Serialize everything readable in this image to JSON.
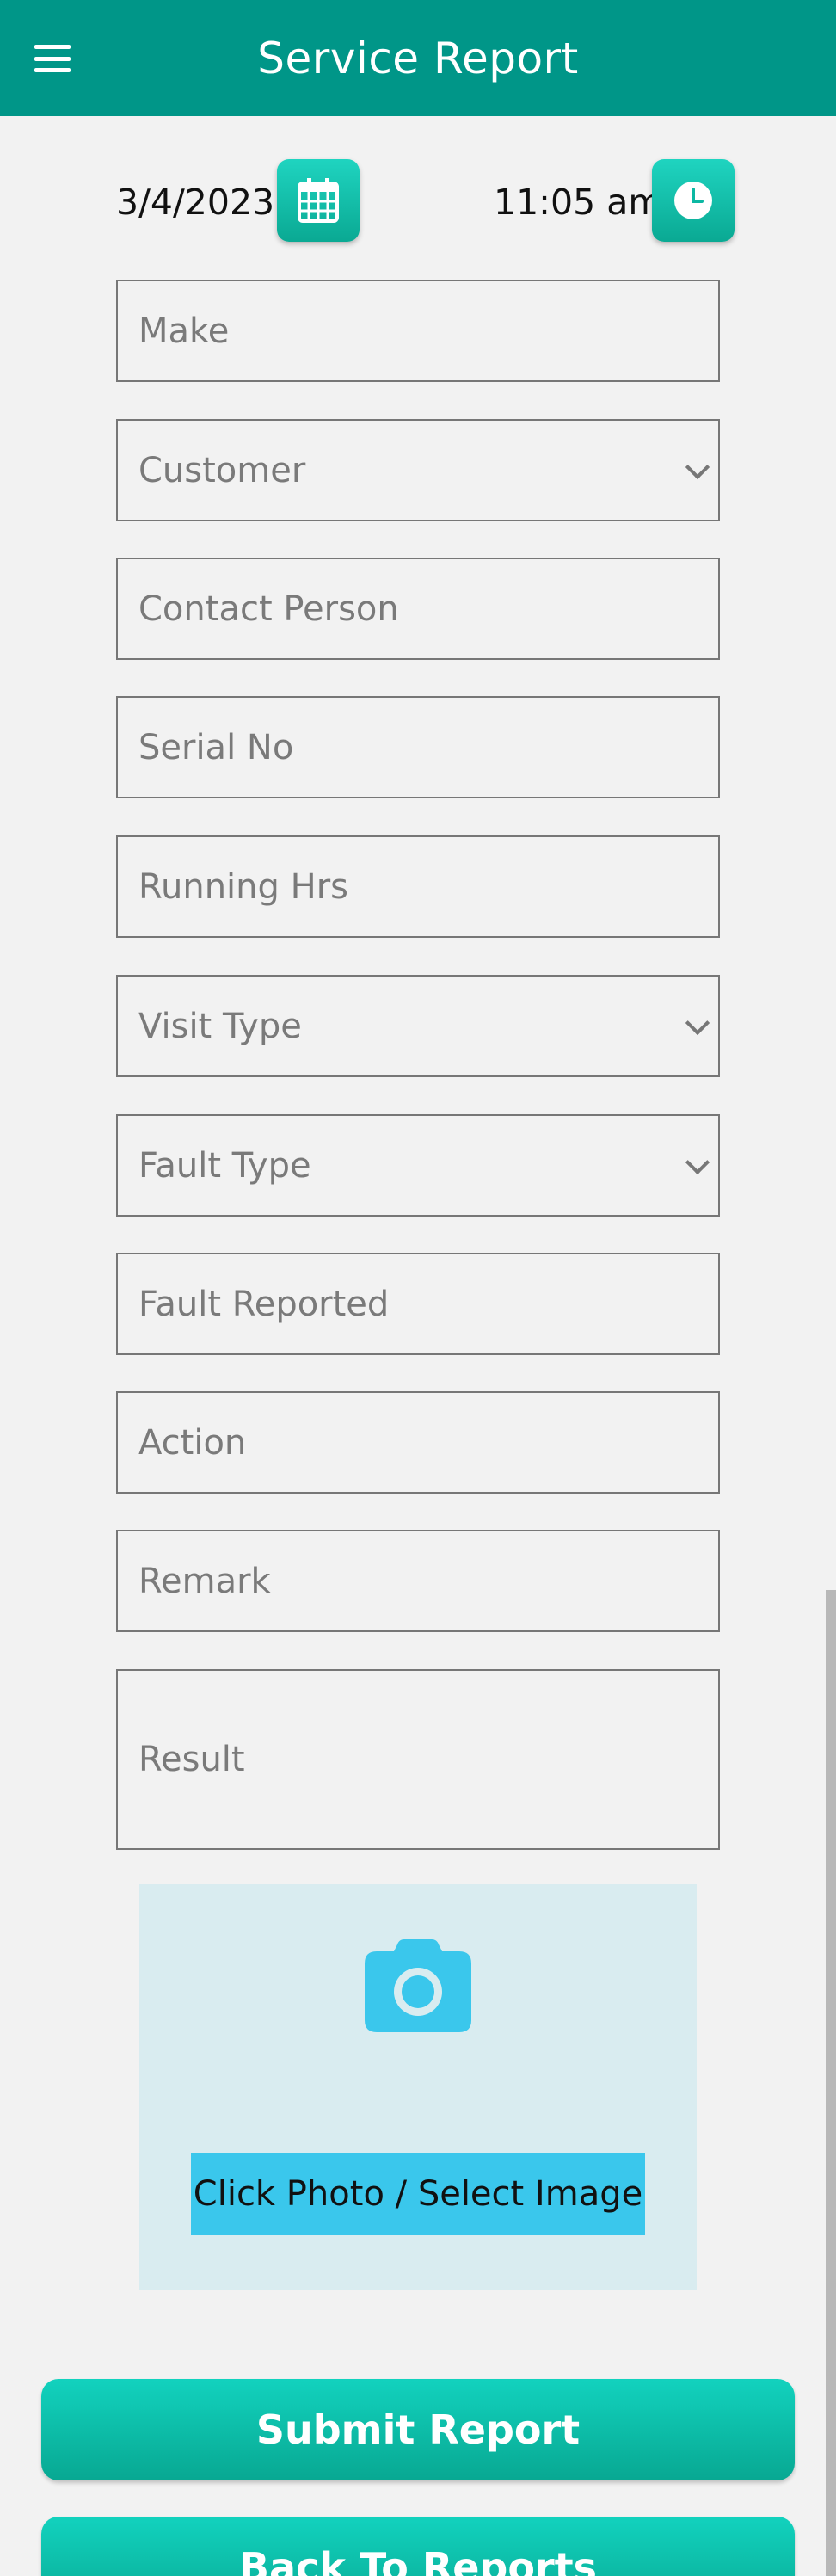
{
  "header": {
    "title": "Service Report",
    "menu_icon": "hamburger-menu-icon"
  },
  "datetime": {
    "date": "3/4/2023",
    "date_icon": "calendar-icon",
    "time": "11:05 am",
    "time_icon": "clock-icon"
  },
  "fields": {
    "make": "Make",
    "customer": "Customer",
    "contact_person": "Contact Person",
    "serial_no": "Serial No",
    "running_hrs": "Running Hrs",
    "visit_type": "Visit Type",
    "fault_type": "Fault Type",
    "fault_reported": "Fault Reported",
    "action": "Action",
    "remark": "Remark",
    "result": "Result"
  },
  "photo": {
    "icon": "camera-icon",
    "button_label": "Click Photo / Select Image"
  },
  "buttons": {
    "submit": "Submit Report",
    "back": "Back To Reports"
  },
  "colors": {
    "header": "#009688",
    "accent": "#12d2be",
    "photo_button": "#3ac7ec",
    "photo_area": "#d9ecf0"
  }
}
